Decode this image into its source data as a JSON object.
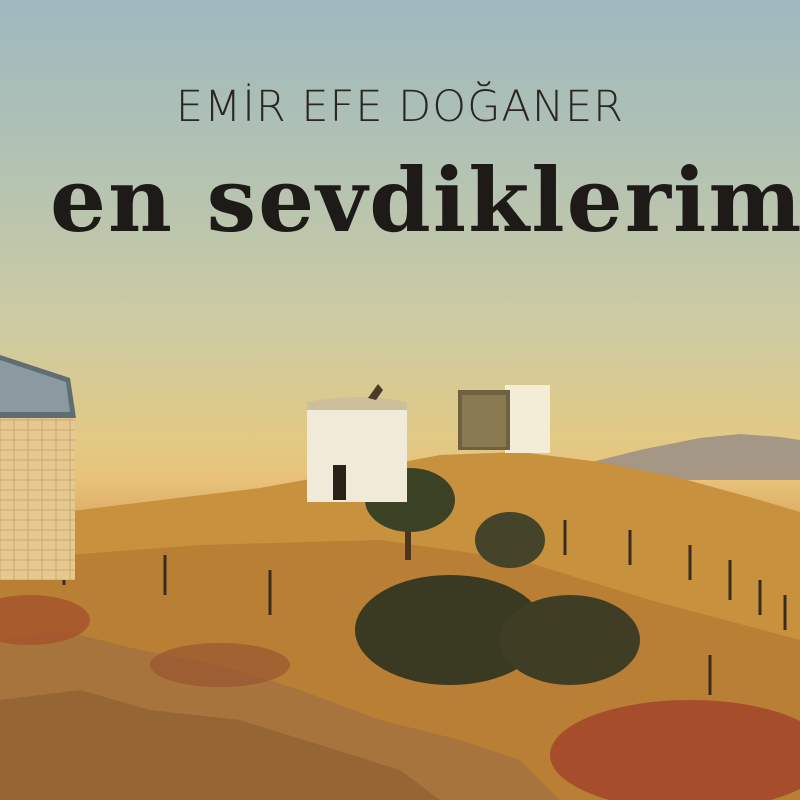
{
  "artist": "EMİR EFE DOĞANER",
  "album_title": "en sevdiklerim",
  "colors": {
    "sky_top": "#9fb8bf",
    "sky_horizon": "#e8c27a",
    "ground": "#c58a3a",
    "text": "#1e1a18"
  }
}
